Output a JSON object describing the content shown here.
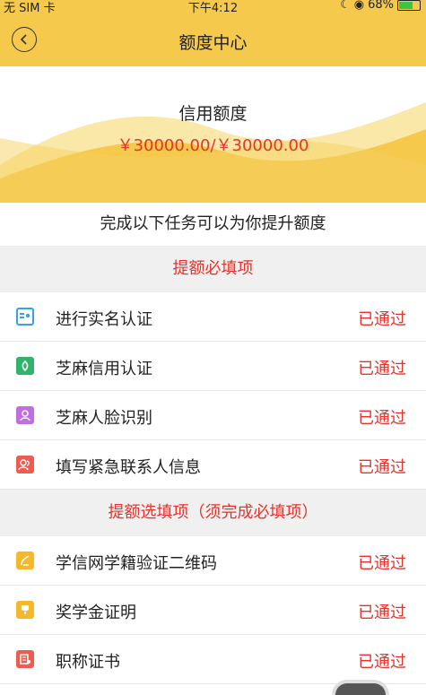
{
  "status_bar": {
    "carrier": "无 SIM 卡",
    "time": "下午4:12",
    "battery": "68%",
    "battery_level": 0.68
  },
  "nav": {
    "title": "额度中心",
    "back_icon": "chevron-left-circle-icon"
  },
  "credit": {
    "label": "信用额度",
    "amount": "￥30000.00/￥30000.00"
  },
  "tasks_heading": "完成以下任务可以为你提升额度",
  "required_section": {
    "title": "提额必填项",
    "items": [
      {
        "label": "进行实名认证",
        "status": "已通过",
        "icon": "id-card-icon",
        "color": "#3aa0e8"
      },
      {
        "label": "芝麻信用认证",
        "status": "已通过",
        "icon": "sesame-icon",
        "color": "#32b36a"
      },
      {
        "label": "芝麻人脸识别",
        "status": "已通过",
        "icon": "face-icon",
        "color": "#c06ee0"
      },
      {
        "label": "填写紧急联系人信息",
        "status": "已通过",
        "icon": "contacts-icon",
        "color": "#ef5b4e"
      }
    ]
  },
  "optional_section": {
    "title": "提额选填项（须完成必填项）",
    "items": [
      {
        "label": "学信网学籍验证二维码",
        "status": "已通过",
        "icon": "edu-icon",
        "color": "#f5b82a"
      },
      {
        "label": "奖学金证明",
        "status": "已通过",
        "icon": "trophy-icon",
        "color": "#f5b82a"
      },
      {
        "label": "职称证书",
        "status": "已通过",
        "icon": "certificate-icon",
        "color": "#ef5b4e"
      }
    ]
  }
}
